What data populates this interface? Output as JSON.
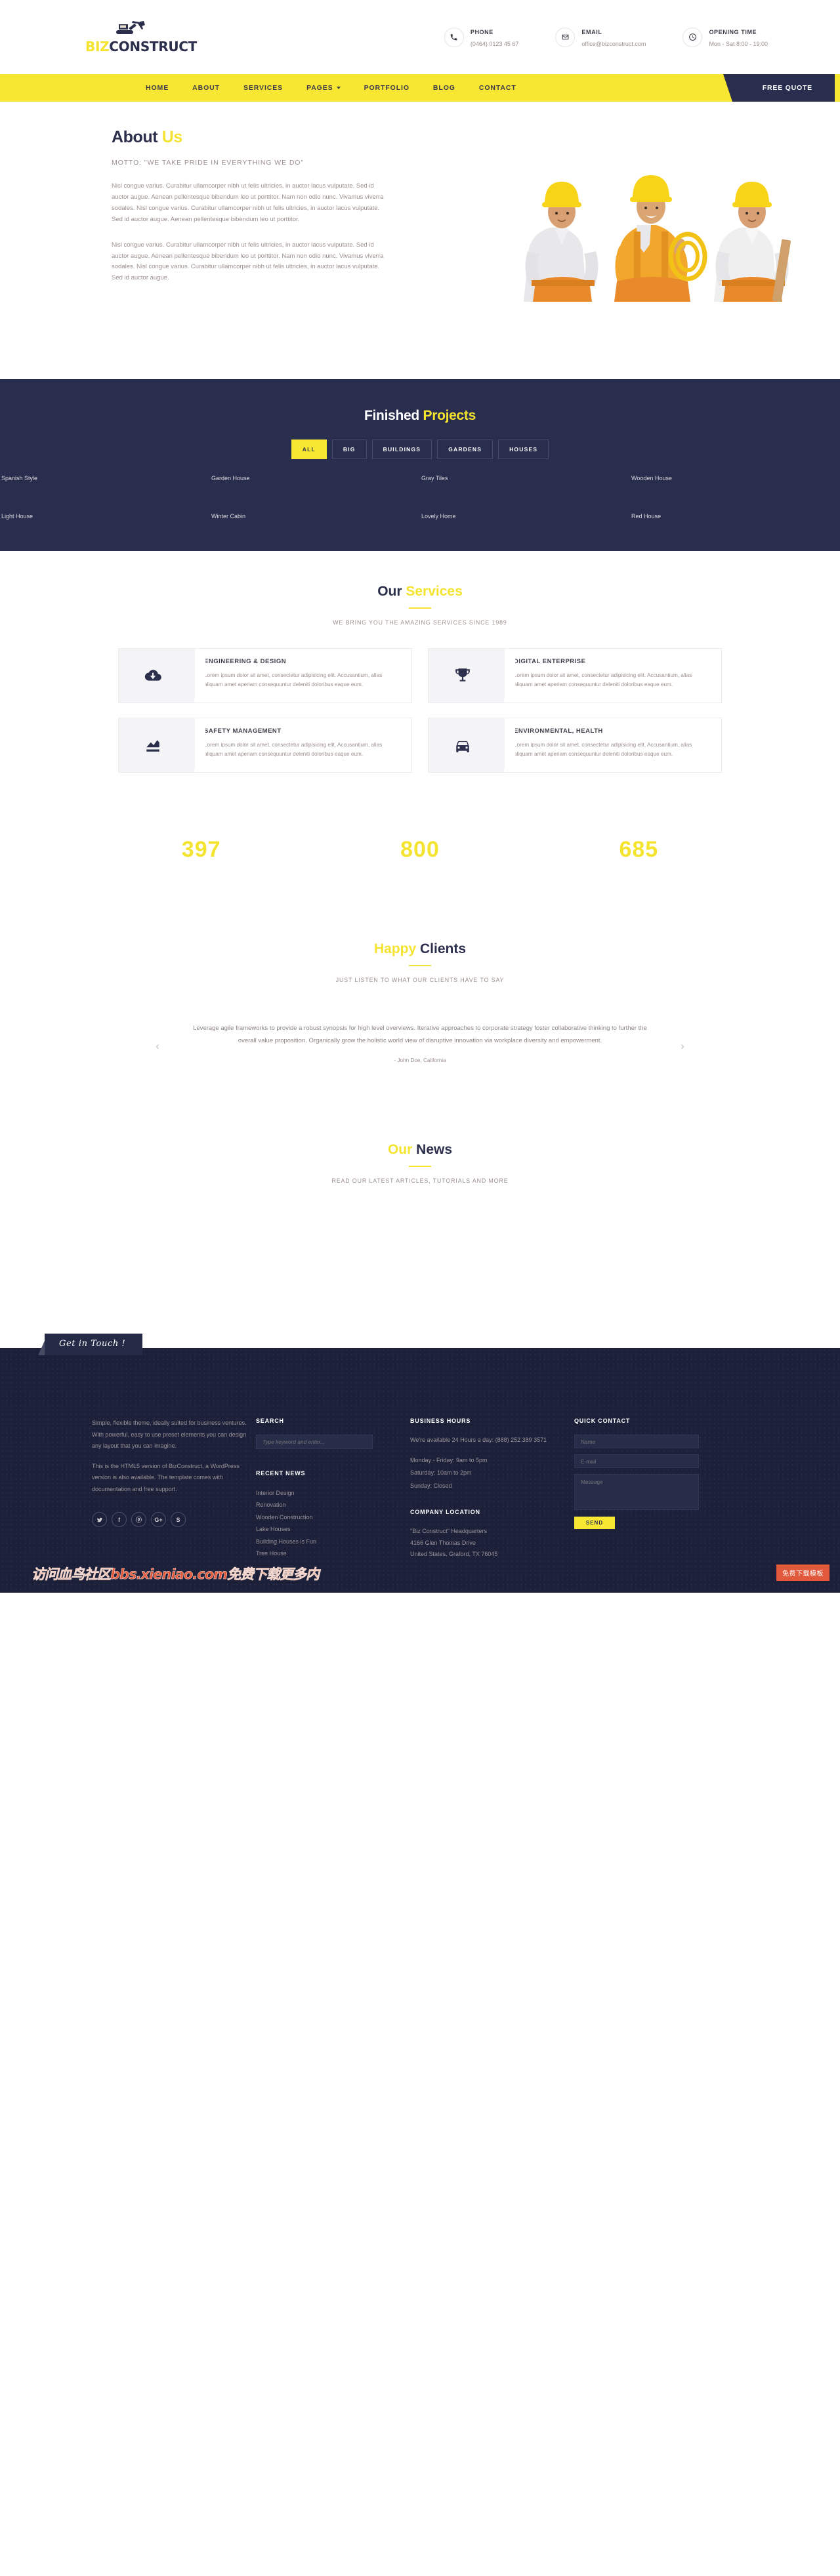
{
  "brand": {
    "part1": "BIZ",
    "part2": "CONSTRUCT"
  },
  "topbar": {
    "contacts": [
      {
        "icon": "phone-icon",
        "label": "PHONE",
        "value": "(0464) 0123 45 67"
      },
      {
        "icon": "envelope-icon",
        "label": "EMAIL",
        "value": "office@bizconstruct.com"
      },
      {
        "icon": "clock-icon",
        "label": "OPENING TIME",
        "value": "Mon - Sat 8:00 - 19:00"
      }
    ]
  },
  "nav": {
    "items": [
      {
        "label": "HOME",
        "dropdown": false
      },
      {
        "label": "ABOUT",
        "dropdown": false
      },
      {
        "label": "SERVICES",
        "dropdown": false
      },
      {
        "label": "PAGES",
        "dropdown": true
      },
      {
        "label": "PORTFOLIO",
        "dropdown": false
      },
      {
        "label": "BLOG",
        "dropdown": false
      },
      {
        "label": "CONTACT",
        "dropdown": false
      }
    ],
    "quote_label": "FREE QUOTE"
  },
  "about": {
    "title_main": "About",
    "title_hl": "Us",
    "motto": "MOTTO: \"WE TAKE PRIDE IN EVERYTHING WE DO\"",
    "paragraph1": "Nisl congue varius. Curabitur ullamcorper nibh ut felis ultricies, in auctor lacus vulputate. Sed id auctor augue. Aenean pellentesque bibendum leo ut porttitor. Nam non odio nunc. Vivamus viverra sodales. Nisl congue varius. Curabitur ullamcorper nibh ut felis ultricies, in auctor lacus vulputate. Sed id auctor augue. Aenean pellentesque bibendum leo ut porttitor.",
    "paragraph2": "Nisl congue varius. Curabitur ullamcorper nibh ut felis ultricies, in auctor lacus vulputate. Sed id auctor augue. Aenean pellentesque bibendum leo ut porttitor. Nam non odio nunc. Vivamus viverra sodales. Nisl congue varius. Curabitur ullamcorper nibh ut felis ultricies, in auctor lacus vulputate. Sed id auctor augue."
  },
  "projects": {
    "title_main": "Finished",
    "title_hl": "Projects",
    "filters": [
      {
        "label": "ALL",
        "active": true
      },
      {
        "label": "BIG",
        "active": false
      },
      {
        "label": "BUILDINGS",
        "active": false
      },
      {
        "label": "GARDENS",
        "active": false
      },
      {
        "label": "HOUSES",
        "active": false
      }
    ],
    "items": [
      "Spanish Style",
      "Garden House",
      "Gray Tiles",
      "Wooden House",
      "Light House",
      "Winter Cabin",
      "Lovely Home",
      "Red House"
    ]
  },
  "services": {
    "title_main": "Our",
    "title_hl": "Services",
    "subtitle": "WE BRING YOU THE AMAZING SERVICES SINCE 1989",
    "cards": [
      {
        "icon": "cloud-download-icon",
        "title": "ENGINEERING & DESIGN",
        "text": "Lorem ipsum dolor sit amet, consectetur adipisicing elit. Accusantium, alias aliquam amet aperiam consequuntur deleniti doloribus eaque eum."
      },
      {
        "icon": "trophy-icon",
        "title": "DIGITAL ENTERPRISE",
        "text": "Lorem ipsum dolor sit amet, consectetur adipisicing elit. Accusantium, alias aliquam amet aperiam consequuntur deleniti doloribus eaque eum."
      },
      {
        "icon": "chart-icon",
        "title": "SAFETY MANAGEMENT",
        "text": "Lorem ipsum dolor sit amet, consectetur adipisicing elit. Accusantium, alias aliquam amet aperiam consequuntur deleniti doloribus eaque eum."
      },
      {
        "icon": "car-icon",
        "title": "ENVIRONMENTAL, HEALTH",
        "text": "Lorem ipsum dolor sit amet, consectetur adipisicing elit. Accusantium, alias aliquam amet aperiam consequuntur deleniti doloribus eaque eum."
      }
    ]
  },
  "counters": [
    {
      "number": "397",
      "label": ""
    },
    {
      "number": "800",
      "label": ""
    },
    {
      "number": "685",
      "label": ""
    }
  ],
  "testimonials": {
    "title_main": "Happy",
    "title_hl": "Clients",
    "subtitle": "JUST LISTEN TO WHAT OUR CLIENTS HAVE TO SAY",
    "quote": "Leverage agile frameworks to provide a robust synopsis for high level overviews. Iterative approaches to corporate strategy foster collaborative thinking to further the overall value proposition. Organically grow the holistic world view of disruptive innovation via workplace diversity and empowerment.",
    "author": "- John Doe, California",
    "prev": "‹",
    "next": "›"
  },
  "news": {
    "title_main": "Our",
    "title_hl": "News",
    "subtitle": "READ OUR LATEST ARTICLES, TUTORIALS AND MORE"
  },
  "footer": {
    "badge": "Get in Touch !",
    "about_p1": "Simple, flexible theme, ideally suited for business ventures. With powerful, easy to use preset elements you can design any layout that you can imagine.",
    "about_p2": "This is the HTML5 version of BizConstruct, a WordPress version is also available. The template comes with documentation and free support.",
    "socials": [
      {
        "name": "twitter-icon",
        "glyph": ""
      },
      {
        "name": "facebook-icon",
        "glyph": "f"
      },
      {
        "name": "pinterest-icon",
        "glyph": "ⓟ"
      },
      {
        "name": "google-plus-icon",
        "glyph": "G+"
      },
      {
        "name": "skype-icon",
        "glyph": "S"
      }
    ],
    "search_heading": "SEARCH",
    "search_placeholder": "Type keyword and enter...",
    "recent_heading": "RECENT NEWS",
    "recent_items": [
      "Interior Design",
      "Renovation",
      "Wooden Construction",
      "Lake Houses",
      "Building Houses is Fun",
      "Tree House"
    ],
    "hours_heading": "BUSINESS HOURS",
    "hours_available": "We're available 24 Hours a day: (888) 252 389 3571",
    "hours_mon": "Monday - Friday: 9am to 5pm",
    "hours_sat": "Saturday: 10am to 2pm",
    "hours_sun": "Sunday: Closed",
    "location_heading": "COMPANY LOCATION",
    "location_line1": "\"Biz Construct\" Headquarters",
    "location_line2": "4166 Glen Thomas Drive",
    "location_line3": "United States, Graford, TX 76045",
    "contact_heading": "QUICK CONTACT",
    "name_placeholder": "Name",
    "email_placeholder": "E-mail",
    "message_placeholder": "Message",
    "send_label": "SEND"
  },
  "overlay": {
    "watermark": "访问血鸟社区bbs.xieniao.com免费下载更多内",
    "badge": "免费下载模板"
  },
  "colors": {
    "yellow": "#F7E733",
    "navy": "#292E4F",
    "footer": "#1C2039"
  }
}
